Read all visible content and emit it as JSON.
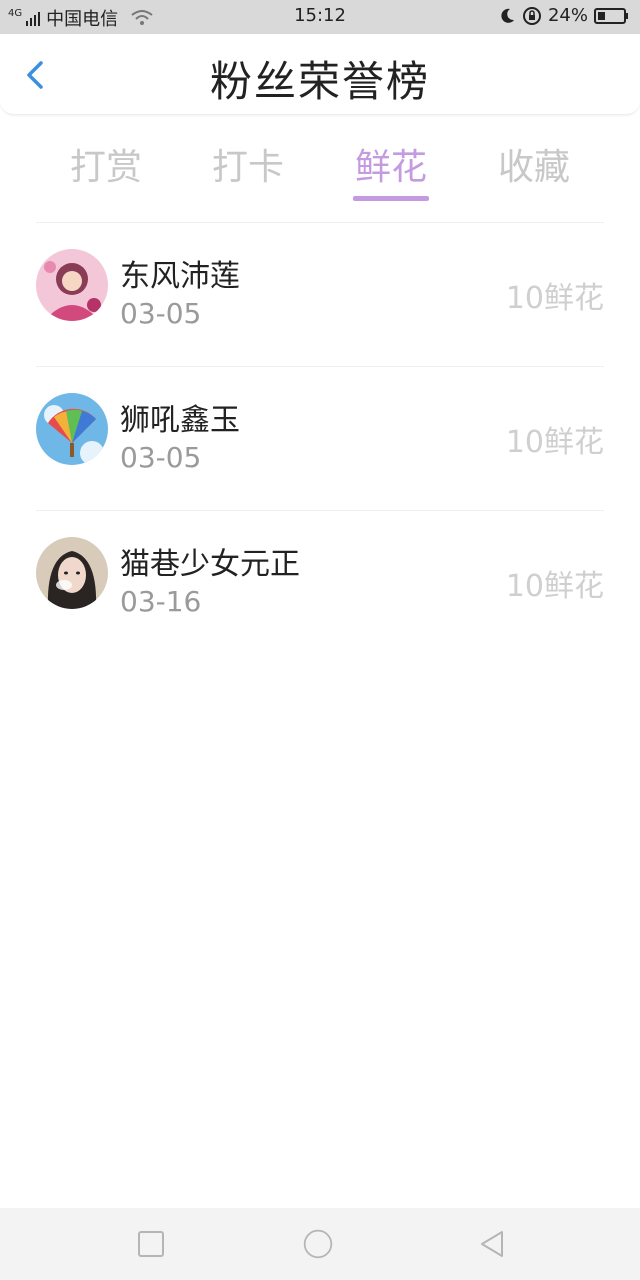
{
  "status_bar": {
    "network": "4G",
    "carrier": "中国电信",
    "time": "15:12",
    "battery": "24%"
  },
  "header": {
    "title": "粉丝荣誉榜"
  },
  "tabs": [
    {
      "label": "打赏",
      "active": false
    },
    {
      "label": "打卡",
      "active": false
    },
    {
      "label": "鲜花",
      "active": true
    },
    {
      "label": "收藏",
      "active": false
    }
  ],
  "list": [
    {
      "name": "东风沛莲",
      "date": "03-05",
      "amount": "10鲜花"
    },
    {
      "name": "狮吼鑫玉",
      "date": "03-05",
      "amount": "10鲜花"
    },
    {
      "name": "猫巷少女元正",
      "date": "03-16",
      "amount": "10鲜花"
    }
  ],
  "colors": {
    "accent": "#c49be0",
    "back_icon": "#3a8fe0"
  }
}
